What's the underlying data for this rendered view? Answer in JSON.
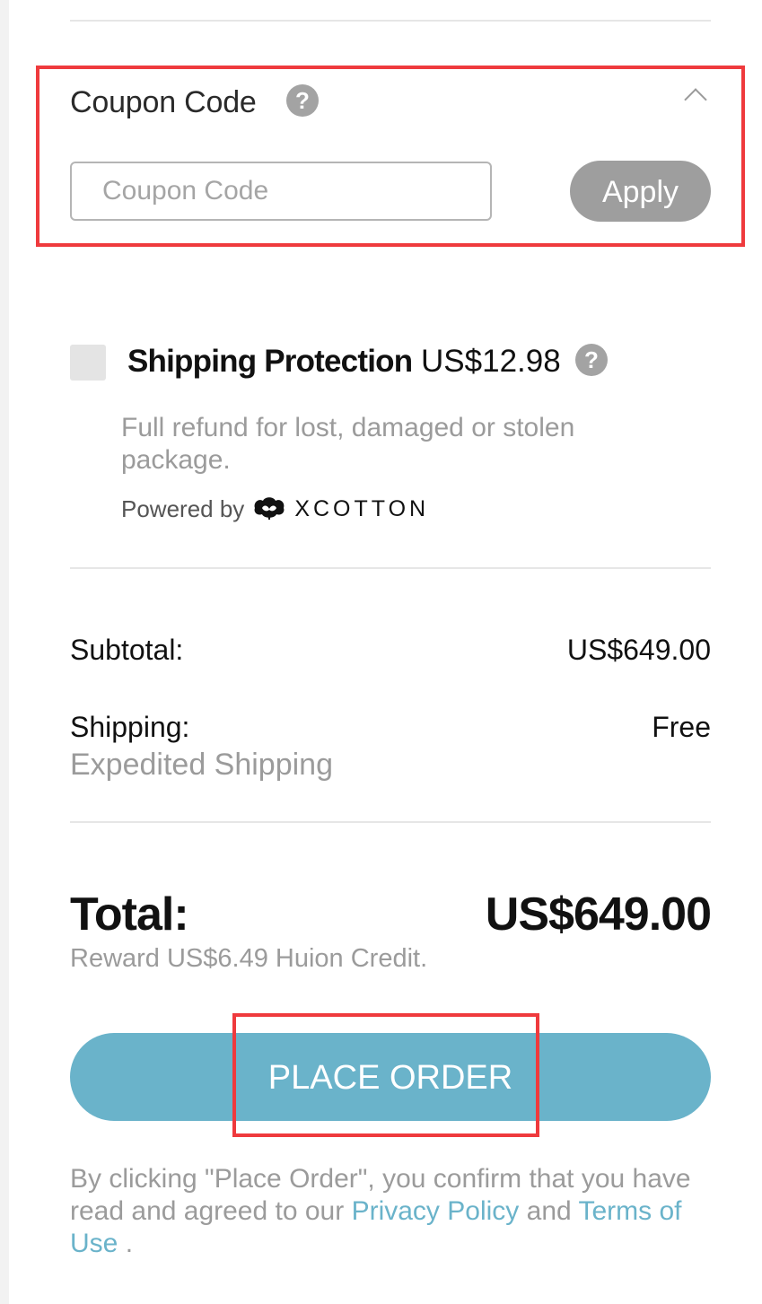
{
  "coupon": {
    "title": "Coupon Code",
    "help_icon": "question-circle-icon",
    "toggle_icon": "chevron-up-icon",
    "input_placeholder": "Coupon Code",
    "input_value": "",
    "apply_label": "Apply"
  },
  "shipping_protection": {
    "checked": false,
    "title": "Shipping Protection",
    "price": "US$12.98",
    "help_icon": "question-circle-icon",
    "description": "Full refund for lost, damaged or stolen package.",
    "powered_by": "Powered by",
    "brand_logo_icon": "cotton-logo-icon",
    "brand_name": "XCOTTON"
  },
  "summary": {
    "subtotal_label": "Subtotal:",
    "subtotal_value": "US$649.00",
    "shipping_label": "Shipping:",
    "shipping_value": "Free",
    "shipping_method": "Expedited Shipping",
    "total_label": "Total:",
    "total_value": "US$649.00",
    "reward_text": "Reward US$6.49 Huion Credit."
  },
  "order": {
    "place_order_label": "PLACE ORDER",
    "legal_prefix": "By clicking \"Place Order\", you confirm that you have read and agreed to our",
    "privacy_link": "Privacy Policy",
    "legal_and": "and",
    "terms_link": "Terms of Use",
    "legal_suffix": "."
  },
  "colors": {
    "accent": "#6ab3ca",
    "highlight": "#ef3a3d",
    "muted_text": "#9b9b9b",
    "apply_button": "#9e9e9e"
  }
}
